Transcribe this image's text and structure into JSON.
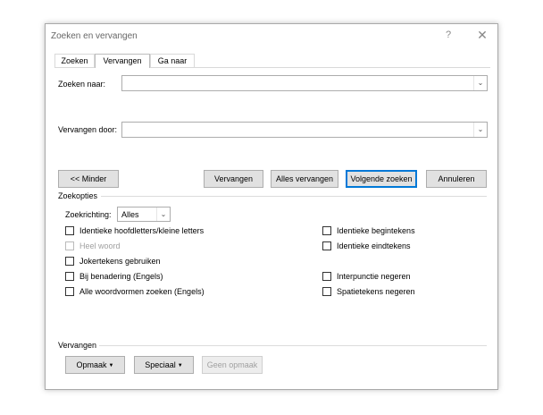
{
  "dialog": {
    "title": "Zoeken en vervangen",
    "help_label": "?",
    "close_label": "✕"
  },
  "tabs": [
    {
      "label": "Zoeken",
      "active": false
    },
    {
      "label": "Vervangen",
      "active": true
    },
    {
      "label": "Ga naar",
      "active": false
    }
  ],
  "find": {
    "label": "Zoeken naar:",
    "value": ""
  },
  "replace": {
    "label": "Vervangen door:",
    "value": ""
  },
  "buttons": {
    "less": "<< Minder",
    "replace": "Vervangen",
    "replace_all": "Alles vervangen",
    "find_next": "Volgende zoeken",
    "cancel": "Annuleren"
  },
  "options": {
    "section_label": "Zoekopties",
    "direction_label": "Zoekrichting:",
    "direction_value": "Alles",
    "left": [
      {
        "label": "Identieke hoofdletters/kleine letters",
        "checked": false,
        "enabled": true
      },
      {
        "label": "Heel woord",
        "checked": false,
        "enabled": false
      },
      {
        "label": "Jokertekens gebruiken",
        "checked": false,
        "enabled": true
      },
      {
        "label": "Bij benadering (Engels)",
        "checked": false,
        "enabled": true
      },
      {
        "label": "Alle woordvormen zoeken (Engels)",
        "checked": false,
        "enabled": true
      }
    ],
    "right": [
      {
        "label": "Identieke begintekens",
        "checked": false,
        "enabled": true
      },
      {
        "label": "Identieke eindtekens",
        "checked": false,
        "enabled": true
      },
      {
        "label": "Interpunctie negeren",
        "checked": false,
        "enabled": true
      },
      {
        "label": "Spatietekens negeren",
        "checked": false,
        "enabled": true
      }
    ]
  },
  "replace_section": {
    "label": "Vervangen",
    "format_button": "Opmaak",
    "special_button": "Speciaal",
    "no_format_button": "Geen opmaak"
  },
  "icons": {
    "dropdown": "chevron-down-icon",
    "menu_arrow": "triangle-down-icon"
  }
}
